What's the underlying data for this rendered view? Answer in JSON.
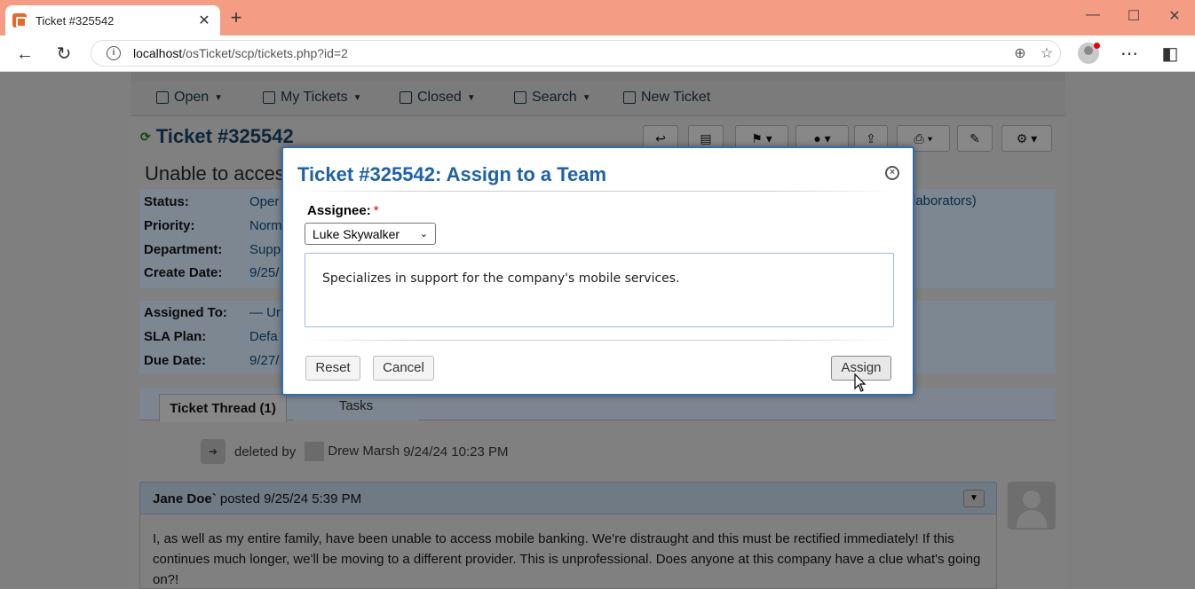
{
  "browser": {
    "tab_title": "Ticket #325542",
    "url_host": "localhost",
    "url_path": "/osTicket/scp/tickets.php?id=2"
  },
  "subnav": {
    "items": [
      {
        "label": "Open"
      },
      {
        "label": "My Tickets"
      },
      {
        "label": "Closed"
      },
      {
        "label": "Search"
      },
      {
        "label": "New Ticket"
      }
    ]
  },
  "ticket": {
    "title": "Ticket #325542",
    "subject": "Unable to acces",
    "fields": [
      {
        "label": "Status:",
        "value": "Oper"
      },
      {
        "label": "Priority:",
        "value": "Norm"
      },
      {
        "label": "Department:",
        "value": "Supp"
      },
      {
        "label": "Create Date:",
        "value": "9/25/"
      }
    ],
    "fields2": [
      {
        "label": "Assigned To:",
        "value": "— Ur"
      },
      {
        "label": "SLA Plan:",
        "value": "Defa"
      },
      {
        "label": "Due Date:",
        "value": "9/27/"
      }
    ],
    "collaborators": "laborators)"
  },
  "tabs": {
    "thread": "Ticket Thread (1)",
    "tasks": "Tasks"
  },
  "event": {
    "text": "deleted by",
    "user": "Drew Marsh",
    "time": "9/24/24 10:23 PM"
  },
  "post": {
    "author": "Jane Doe`",
    "meta": "posted 9/25/24 5:39 PM",
    "body": "I, as well as my entire family, have been unable to access mobile banking. We're distraught and this must be rectified immediately! If this continues much longer, we'll be moving to a different provider. This is unprofessional. Does anyone at this company have a clue what's going on?!"
  },
  "modal": {
    "title": "Ticket #325542: Assign to a Team",
    "assignee_label": "Assignee:",
    "required_mark": "*",
    "assignee_value": "Luke Skywalker",
    "description": "Specializes in support for the company's mobile services.",
    "reset_label": "Reset",
    "cancel_label": "Cancel",
    "assign_label": "Assign"
  }
}
